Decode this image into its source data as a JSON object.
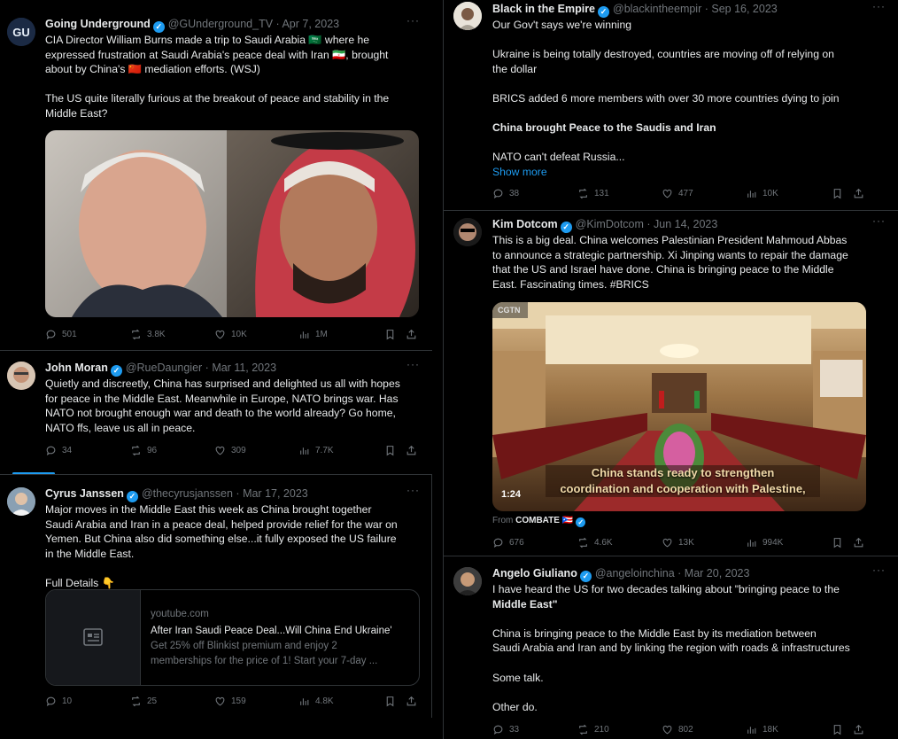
{
  "left": [
    {
      "name": "Going Underground",
      "handle": "@GUnderground_TV",
      "date": "Apr 7, 2023",
      "lines": [
        "CIA Director William Burns made a trip to Saudi Arabia 🇸🇦 where he",
        "expressed frustration at Saudi Arabia's peace deal with Iran 🇮🇷, brought",
        "about by China's 🇨🇳 mediation efforts. (WSJ)",
        "",
        "The US quite literally furious at the breakout of peace and stability in the",
        "Middle East?"
      ],
      "stats": {
        "replies": "501",
        "retweets": "3.8K",
        "likes": "10K",
        "views": "1M"
      }
    },
    {
      "name": "John Moran",
      "handle": "@RueDaungier",
      "date": "Mar 11, 2023",
      "lines": [
        "Quietly and discreetly, China has surprised and delighted us all with hopes",
        "for peace in the Middle East. Meanwhile in Europe, NATO brings war. Has",
        "NATO not brought enough war and death to the world already? Go  home,",
        "NATO ffs, leave us all in peace."
      ],
      "stats": {
        "replies": "34",
        "retweets": "96",
        "likes": "309",
        "views": "7.7K"
      }
    },
    {
      "name": "Cyrus Janssen",
      "handle": "@thecyrusjanssen",
      "date": "Mar 17, 2023",
      "lines": [
        "Major moves in the Middle East this week as China brought together",
        "Saudi Arabia and Iran in a peace deal, helped provide relief for the war on",
        "Yemen. But China also did something else...it fully exposed the US failure",
        "in the Middle East.",
        "",
        "Full Details 👇"
      ],
      "card": {
        "domain": "youtube.com",
        "title": "After Iran Saudi Peace Deal...Will China End Ukraine'",
        "desc1": "Get 25% off Blinkist premium and enjoy 2",
        "desc2": "memberships for the price of 1! Start your 7-day ..."
      },
      "stats": {
        "replies": "10",
        "retweets": "25",
        "likes": "159",
        "views": "4.8K"
      }
    }
  ],
  "right": [
    {
      "name": "Black in the Empire",
      "handle": "@blackintheempir",
      "date": "Sep 16, 2023",
      "lines": [
        "Our Gov't says we're winning",
        "",
        "Ukraine is being totally destroyed, countries are moving off of relying on",
        "the dollar",
        "",
        "BRICS added 6 more members with over 30 more countries dying to join",
        "",
        "China brought Peace to the Saudis and Iran",
        "",
        "NATO can't defeat Russia..."
      ],
      "show_more": "Show more",
      "stats": {
        "replies": "38",
        "retweets": "131",
        "likes": "477",
        "views": "10K"
      }
    },
    {
      "name": "Kim Dotcom",
      "handle": "@KimDotcom",
      "date": "Jun 14, 2023",
      "lines": [
        "This is a big deal. China welcomes Palestinian President Mahmoud Abbas",
        "to announce a strategic partnership. Xi Jinping wants to repair the damage",
        "that the US and Israel have done. China is bringing peace to the Middle",
        "East. Fascinating times. #BRICS"
      ],
      "video": {
        "logo": "CGTN",
        "caption1": "China stands ready to strengthen",
        "caption2": "coordination and cooperation with Palestine,",
        "duration": "1:24"
      },
      "from_label": "From",
      "from_account": "COMBATE 🇵🇷",
      "stats": {
        "replies": "676",
        "retweets": "4.6K",
        "likes": "13K",
        "views": "994K"
      }
    },
    {
      "name": "Angelo Giuliano",
      "handle": "@angeloinchina",
      "date": "Mar 20, 2023",
      "lines": [
        "I have heard the US for two decades talking about \"bringing peace to the",
        "Middle East\"",
        "",
        "China is bringing peace to the Middle East by its mediation between",
        "Saudi Arabia and Iran and by linking the region with roads & infrastructures",
        "",
        "Some talk.",
        "",
        "Other do."
      ],
      "stats": {
        "replies": "33",
        "retweets": "210",
        "likes": "802",
        "views": "18K"
      }
    }
  ],
  "ui": {
    "more": "···",
    "separator": " · ",
    "verified_mark": "✓"
  }
}
